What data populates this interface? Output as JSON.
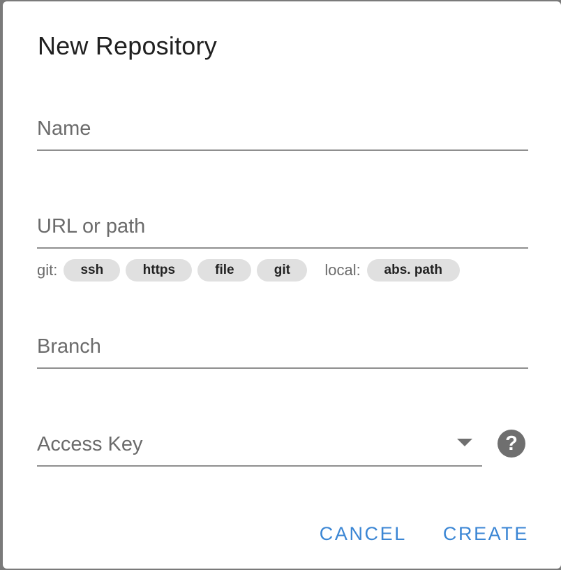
{
  "dialog": {
    "title": "New Repository"
  },
  "fields": {
    "name": {
      "label": "Name",
      "value": ""
    },
    "url": {
      "label": "URL or path",
      "value": ""
    },
    "branch": {
      "label": "Branch",
      "value": ""
    },
    "access_key": {
      "label": "Access Key",
      "value": ""
    }
  },
  "url_hints": {
    "git_label": "git:",
    "git_chips": [
      "ssh",
      "https",
      "file",
      "git"
    ],
    "local_label": "local:",
    "local_chips": [
      "abs. path"
    ]
  },
  "help_icon": {
    "glyph": "?",
    "icon": "help-circle-icon"
  },
  "actions": {
    "cancel_label": "CANCEL",
    "create_label": "CREATE"
  },
  "colors": {
    "accent": "#3b86d4",
    "overlay": "#7a7a7a",
    "chip_bg": "#e0e0e0"
  }
}
